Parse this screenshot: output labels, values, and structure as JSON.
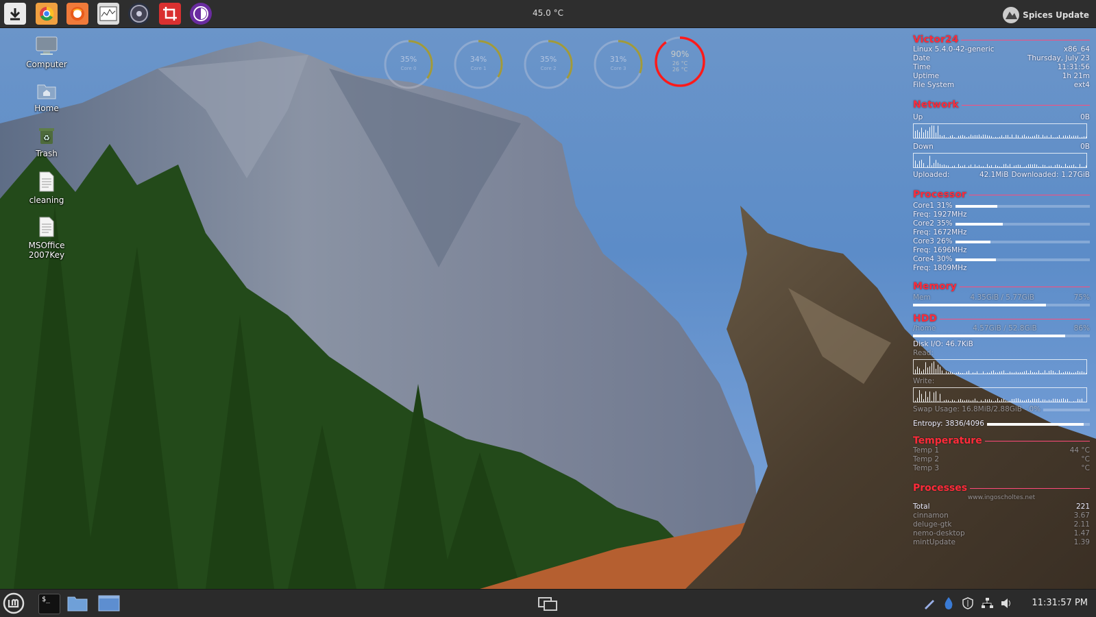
{
  "top_panel": {
    "launchers": [
      "download-icon",
      "chrome-icon",
      "firefox-icon",
      "system-monitor-icon",
      "disk-usage-icon",
      "screenshot-icon",
      "tor-browser-icon"
    ],
    "temperature": "45.0 °C",
    "spices_label": "Spices Update"
  },
  "desktop_icons": [
    {
      "name": "computer",
      "label": "Computer"
    },
    {
      "name": "home",
      "label": "Home"
    },
    {
      "name": "trash",
      "label": "Trash"
    },
    {
      "name": "cleaning",
      "label": "cleaning"
    },
    {
      "name": "msoffice",
      "label": "MSOffice 2007Key"
    }
  ],
  "rings": [
    {
      "pct": "35%",
      "label": "Core 0",
      "value": 0.35
    },
    {
      "pct": "34%",
      "label": "Core 1",
      "value": 0.34
    },
    {
      "pct": "35%",
      "label": "Core 2",
      "value": 0.35
    },
    {
      "pct": "31%",
      "label": "Core 3",
      "value": 0.31
    },
    {
      "pct": "90%",
      "label": "26 °C",
      "label2": "26 °C",
      "value": 0.9
    }
  ],
  "conky": {
    "host": "Victor24",
    "sys": [
      {
        "k": "Linux 5.4.0-42-generic",
        "v": "x86_64"
      },
      {
        "k": "Date",
        "v": "Thursday, July 23"
      },
      {
        "k": "Time",
        "v": "11:31:56"
      },
      {
        "k": "Uptime",
        "v": "1h 21m"
      },
      {
        "k": "File System",
        "v": "ext4"
      }
    ],
    "network": {
      "title": "Network",
      "up_label": "Up",
      "up_value": "0B",
      "down_label": "Down",
      "down_value": "0B",
      "uploaded_label": "Uploaded:",
      "uploaded": "42.1MiB",
      "downloaded_label": "Downloaded:",
      "downloaded": "1.27GiB"
    },
    "processor": {
      "title": "Processor",
      "cores": [
        {
          "core": "Core1 31%",
          "freq": "Freq: 1927MHz",
          "value": 0.31
        },
        {
          "core": "Core2 35%",
          "freq": "Freq: 1672MHz",
          "value": 0.35
        },
        {
          "core": "Core3 26%",
          "freq": "Freq: 1696MHz",
          "value": 0.26
        },
        {
          "core": "Core4 30%",
          "freq": "Freq: 1809MHz",
          "value": 0.3
        }
      ]
    },
    "memory": {
      "title": "Memory",
      "label": "Mem",
      "used": "4.35GiB / 5.77GiB",
      "pct": "75%",
      "value": 0.75
    },
    "hdd": {
      "title": "HDD",
      "mount": "/home",
      "used": "4.57GiB / 52.8GiB",
      "pct": "86%",
      "value": 0.86,
      "diskio": "Disk I/O: 46.7KiB",
      "read": "Read:",
      "write": "Write:",
      "swap": "Swap Usage: 16.8MiB/2.88GiB - 0%",
      "swap_value": 0.0,
      "entropy": "Entropy: 3836/4096",
      "entropy_value": 0.94
    },
    "temperature": {
      "title": "Temperature",
      "temps": [
        {
          "k": "Temp 1",
          "v": "44 °C"
        },
        {
          "k": "Temp 2",
          "v": "°C"
        },
        {
          "k": "Temp 3",
          "v": "°C"
        }
      ]
    },
    "processes": {
      "title": "Processes",
      "total_label": "Total",
      "total": "221",
      "list": [
        {
          "k": "cinnamon",
          "v": "3.67"
        },
        {
          "k": "deluge-gtk",
          "v": "2.11"
        },
        {
          "k": "nemo-desktop",
          "v": "1.47"
        },
        {
          "k": "mintUpdate",
          "v": "1.39"
        }
      ]
    },
    "watermark": "www.ingoscholtes.net"
  },
  "bottom_panel": {
    "clock": "11:31:57 PM",
    "tray": [
      "pen-icon",
      "drop-icon",
      "shield-icon",
      "network-icon",
      "volume-icon"
    ]
  },
  "colors": {
    "conky_red": "#ff2b3a",
    "panel": "#2e2e2e",
    "ring_red": "#ff1a1a",
    "ring_olive": "#a19a3a"
  }
}
